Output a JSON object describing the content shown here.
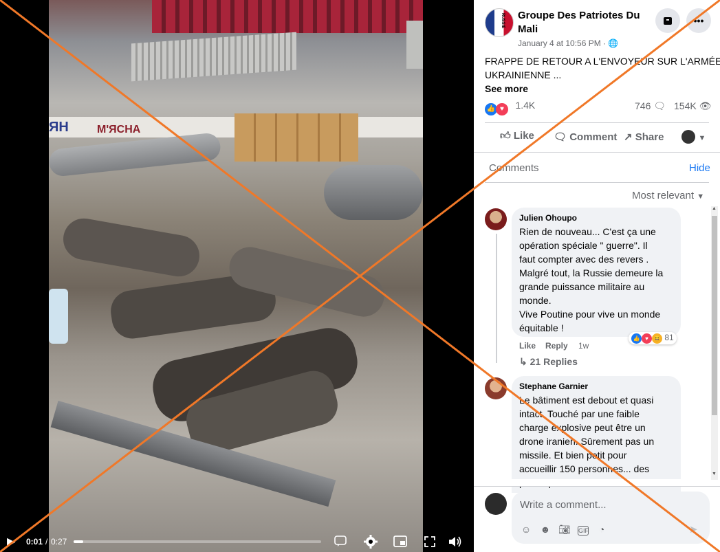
{
  "video": {
    "time_current": "0:01",
    "time_separator": "/",
    "time_total": "0:27",
    "progress_fraction": 0.04,
    "sign_text": "М'ЯСНА",
    "sign_text2": "ЯН"
  },
  "post": {
    "page_name_line1": "Groupe Des Patriotes Du",
    "page_name_line2": "Mali",
    "timestamp": "January 4 at 10:56 PM ·",
    "text_line1": "FRAPPE DE RETOUR A L'ENVOYEUR SUR L'ARMÉE",
    "text_line2": "UKRAINIENNE ...",
    "see_more": "See more",
    "reaction_count": "1.4K",
    "comment_count": "746",
    "view_count": "154K",
    "avatar_label": "RUSSIE"
  },
  "actions": {
    "like": "Like",
    "comment": "Comment",
    "share": "Share"
  },
  "comments_header": {
    "title": "Comments",
    "hide": "Hide",
    "sort": "Most relevant"
  },
  "comments": [
    {
      "author": "Julien Ohoupo",
      "lines": [
        "Rien de nouveau... C'est ça une",
        "opération spéciale \" guerre\". Il",
        "faut compter avec des revers .",
        "Malgré tout, la Russie demeure la",
        "grande puissance militaire au",
        "monde.",
        "Vive Poutine pour vive un monde",
        "équitable !"
      ],
      "like": "Like",
      "reply": "Reply",
      "age": "1w",
      "reactions": "81",
      "replies": "21 Replies"
    },
    {
      "author": "Stephane Garnier",
      "lines": [
        "Le bâtiment est debout et quasi",
        "intact. Touché par une faible",
        "charge explosive peut être un",
        "drone iranien. Sûrement pas un",
        "missile. Et bien petit pour",
        "accueillir 150 personnes... des",
        "portes peut être mais ce"
      ]
    }
  ],
  "composer": {
    "placeholder": "Write a comment..."
  },
  "colors": {
    "facebook_blue": "#1877f2",
    "overlay_cross": "#f07828",
    "text_secondary": "#65676b"
  }
}
